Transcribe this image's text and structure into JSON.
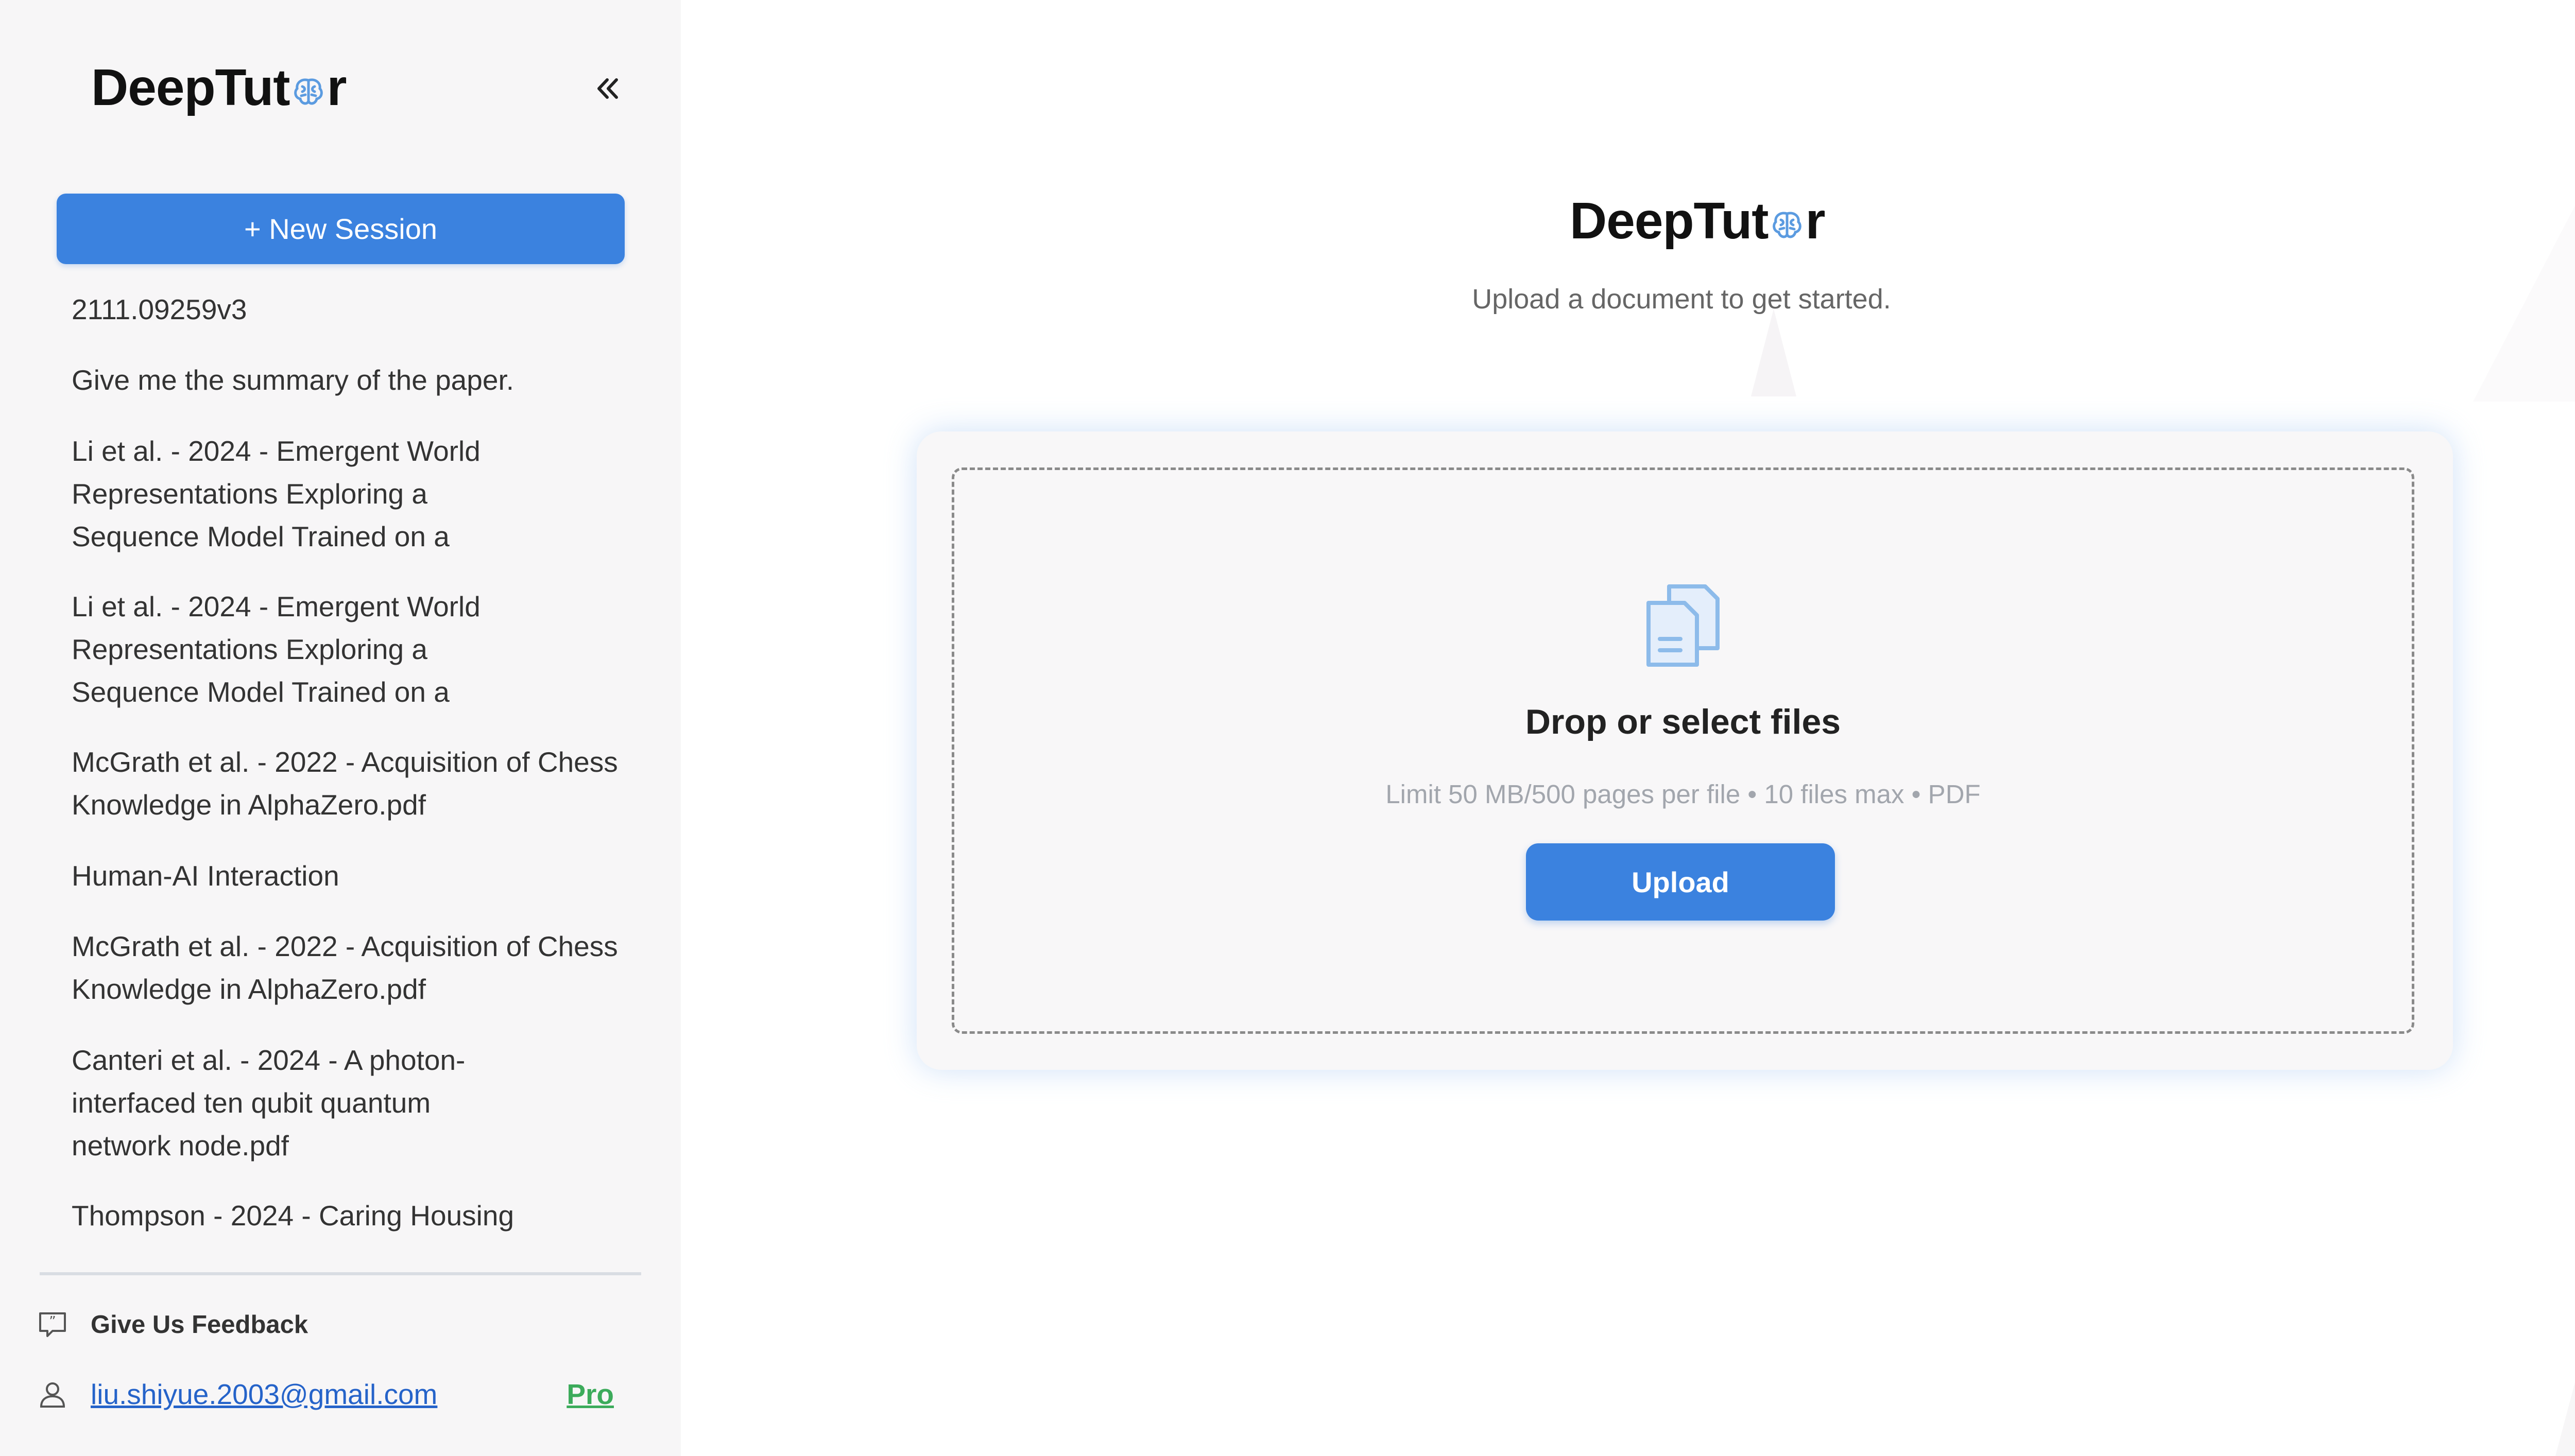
{
  "brand": {
    "prefix": "DeepTut",
    "suffix": "r"
  },
  "sidebar": {
    "collapse_icon": "double-chevron-left-icon",
    "new_session_label": "+ New Session",
    "sessions": [
      "2111.09259v3",
      "Give me the summary of the paper.",
      "Li et al. - 2024 - Emergent World Representations Exploring a Sequence Model Trained on a",
      "Li et al. - 2024 - Emergent World Representations Exploring a Sequence Model Trained on a",
      "McGrath et al. - 2022 - Acquisition of Chess Knowledge in AlphaZero.pdf",
      "Human-AI Interaction",
      "McGrath et al. - 2022 - Acquisition of Chess Knowledge in AlphaZero.pdf",
      "Canteri et al. - 2024 - A photon-interfaced ten qubit quantum network node.pdf",
      "Thompson - 2024 - Caring Housing"
    ],
    "feedback_label": "Give Us Feedback",
    "feedback_icon": "feedback-icon",
    "user_icon": "user-icon",
    "user_email": "liu.shiyue.2003@gmail.com",
    "plan_label": "Pro"
  },
  "main": {
    "subtitle": "Upload a document to get started.",
    "drop_icon": "documents-icon",
    "drop_title": "Drop or select files",
    "limit_text": "Limit 50 MB/500 pages per file • 10 files max • PDF",
    "upload_label": "Upload"
  },
  "colors": {
    "accent": "#3b82df",
    "sidebar_bg": "#f7f6f7",
    "pro_green": "#3cab5b",
    "link_blue": "#2563c9"
  }
}
